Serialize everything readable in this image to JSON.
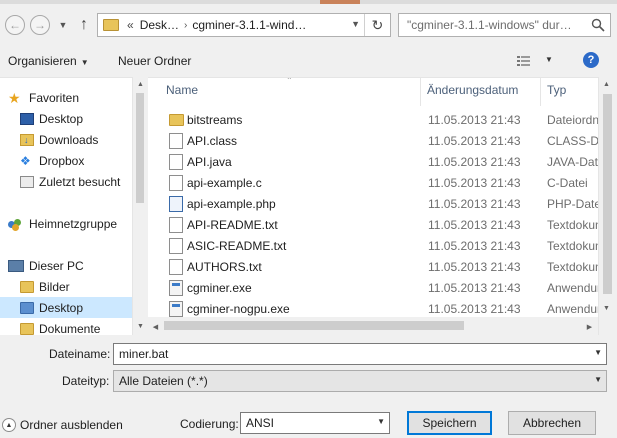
{
  "nav": {
    "back_icon": "back-arrow-icon",
    "forward_icon": "forward-arrow-icon",
    "up_icon": "up-arrow-icon"
  },
  "address": {
    "chevrons": "«",
    "segment1": "Desk…",
    "segment2": "cgminer-3.1.1-wind…",
    "separator": "›"
  },
  "search": {
    "placeholder": "\"cgminer-3.1.1-windows\" dur…"
  },
  "toolbar": {
    "organize_label": "Organisieren",
    "new_folder_label": "Neuer Ordner"
  },
  "sidebar": {
    "items": [
      {
        "label": "Favoriten",
        "icon": "star-icon"
      },
      {
        "label": "Desktop",
        "icon": "desktop-icon"
      },
      {
        "label": "Downloads",
        "icon": "downloads-icon"
      },
      {
        "label": "Dropbox",
        "icon": "dropbox-icon"
      },
      {
        "label": "Zuletzt besucht",
        "icon": "recent-places-icon"
      },
      {
        "label": "Heimnetzgruppe",
        "icon": "homegroup-icon"
      },
      {
        "label": "Dieser PC",
        "icon": "computer-icon"
      },
      {
        "label": "Bilder",
        "icon": "pictures-folder-icon"
      },
      {
        "label": "Desktop",
        "icon": "desktop-folder-icon"
      },
      {
        "label": "Dokumente",
        "icon": "documents-folder-icon"
      }
    ]
  },
  "columns": {
    "name": "Name",
    "date": "Änderungsdatum",
    "type": "Typ"
  },
  "files": [
    {
      "name": "bitstreams",
      "date": "11.05.2013 21:43",
      "type": "Dateiordner",
      "icon": "folder-icon"
    },
    {
      "name": "API.class",
      "date": "11.05.2013 21:43",
      "type": "CLASS-Datei",
      "icon": "file-icon"
    },
    {
      "name": "API.java",
      "date": "11.05.2013 21:43",
      "type": "JAVA-Datei",
      "icon": "file-icon"
    },
    {
      "name": "api-example.c",
      "date": "11.05.2013 21:43",
      "type": "C-Datei",
      "icon": "file-icon"
    },
    {
      "name": "api-example.php",
      "date": "11.05.2013 21:43",
      "type": "PHP-Datei",
      "icon": "php-file-icon"
    },
    {
      "name": "API-README.txt",
      "date": "11.05.2013 21:43",
      "type": "Textdokument",
      "icon": "text-file-icon"
    },
    {
      "name": "ASIC-README.txt",
      "date": "11.05.2013 21:43",
      "type": "Textdokument",
      "icon": "text-file-icon"
    },
    {
      "name": "AUTHORS.txt",
      "date": "11.05.2013 21:43",
      "type": "Textdokument",
      "icon": "text-file-icon"
    },
    {
      "name": "cgminer.exe",
      "date": "11.05.2013 21:43",
      "type": "Anwendung",
      "icon": "exe-icon"
    },
    {
      "name": "cgminer-nogpu.exe",
      "date": "11.05.2013 21:43",
      "type": "Anwendung",
      "icon": "exe-icon"
    }
  ],
  "form": {
    "filename_label": "Dateiname:",
    "filename_value": "miner.bat",
    "filetype_label": "Dateityp:",
    "filetype_value": "Alle Dateien  (*.*)",
    "encoding_label": "Codierung:",
    "encoding_value": "ANSI",
    "hide_folders_label": "Ordner ausblenden",
    "save_label": "Speichern",
    "cancel_label": "Abbrechen"
  },
  "colors": {
    "selection": "#cce8ff",
    "accent": "#0078d7",
    "folder": "#e8c45a",
    "header_text": "#4c607a"
  }
}
